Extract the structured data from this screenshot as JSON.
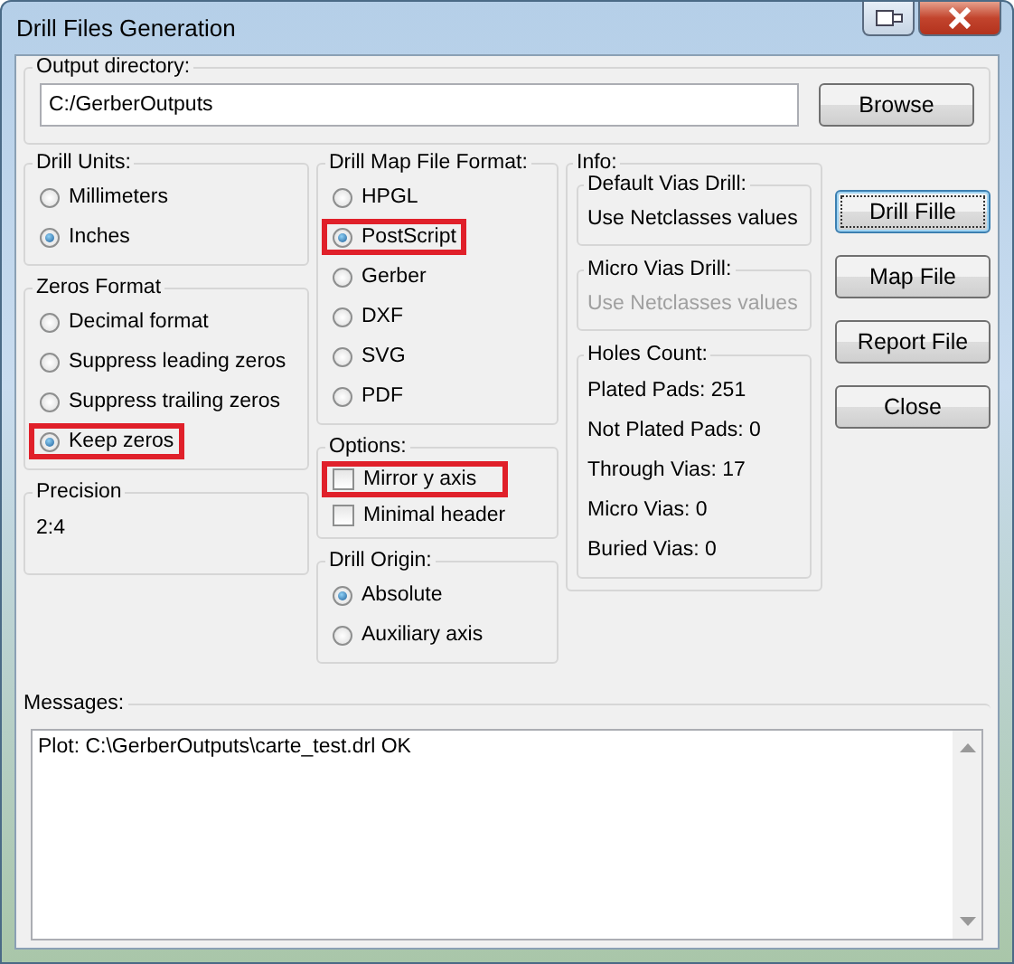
{
  "window": {
    "title": "Drill Files Generation"
  },
  "output_directory": {
    "label": "Output directory:",
    "value": "C:/GerberOutputs",
    "browse_button": "Browse"
  },
  "drill_units": {
    "label": "Drill Units:",
    "options": [
      {
        "label": "Millimeters",
        "selected": false,
        "highlighted": false
      },
      {
        "label": "Inches",
        "selected": true,
        "highlighted": false
      }
    ]
  },
  "zeros_format": {
    "label": "Zeros Format",
    "options": [
      {
        "label": "Decimal format",
        "selected": false,
        "highlighted": false
      },
      {
        "label": "Suppress leading zeros",
        "selected": false,
        "highlighted": false
      },
      {
        "label": "Suppress trailing zeros",
        "selected": false,
        "highlighted": false
      },
      {
        "label": "Keep zeros",
        "selected": true,
        "highlighted": true
      }
    ]
  },
  "precision": {
    "label": "Precision",
    "value": "2:4"
  },
  "drill_map_format": {
    "label": "Drill Map File Format:",
    "options": [
      {
        "label": "HPGL",
        "selected": false,
        "highlighted": false
      },
      {
        "label": "PostScript",
        "selected": true,
        "highlighted": true
      },
      {
        "label": "Gerber",
        "selected": false,
        "highlighted": false
      },
      {
        "label": "DXF",
        "selected": false,
        "highlighted": false
      },
      {
        "label": "SVG",
        "selected": false,
        "highlighted": false
      },
      {
        "label": "PDF",
        "selected": false,
        "highlighted": false
      }
    ]
  },
  "options": {
    "label": "Options:",
    "items": [
      {
        "label": "Mirror y axis",
        "checked": false,
        "highlighted": true
      },
      {
        "label": "Minimal header",
        "checked": false,
        "highlighted": false
      }
    ]
  },
  "drill_origin": {
    "label": "Drill Origin:",
    "options": [
      {
        "label": "Absolute",
        "selected": true,
        "highlighted": false
      },
      {
        "label": "Auxiliary axis",
        "selected": false,
        "highlighted": false
      }
    ]
  },
  "info": {
    "label": "Info:",
    "sections": [
      {
        "kind": "value",
        "title": "Default Vias Drill:",
        "value": "Use Netclasses values",
        "disabled": false
      },
      {
        "kind": "value",
        "title": "Micro Vias Drill:",
        "value": "Use Netclasses values",
        "disabled": true
      },
      {
        "kind": "list",
        "title": "Holes Count:",
        "lines": [
          "Plated Pads: 251",
          "Not Plated Pads: 0",
          "Through Vias: 17",
          "Micro Vias: 0",
          "Buried Vias: 0"
        ]
      }
    ]
  },
  "buttons": [
    {
      "label": "Drill Fille",
      "focused": true
    },
    {
      "label": "Map File",
      "focused": false
    },
    {
      "label": "Report File",
      "focused": false
    },
    {
      "label": "Close",
      "focused": false
    }
  ],
  "messages": {
    "label": "Messages:",
    "text": "Plot: C:\\GerberOutputs\\carte_test.drl OK"
  }
}
